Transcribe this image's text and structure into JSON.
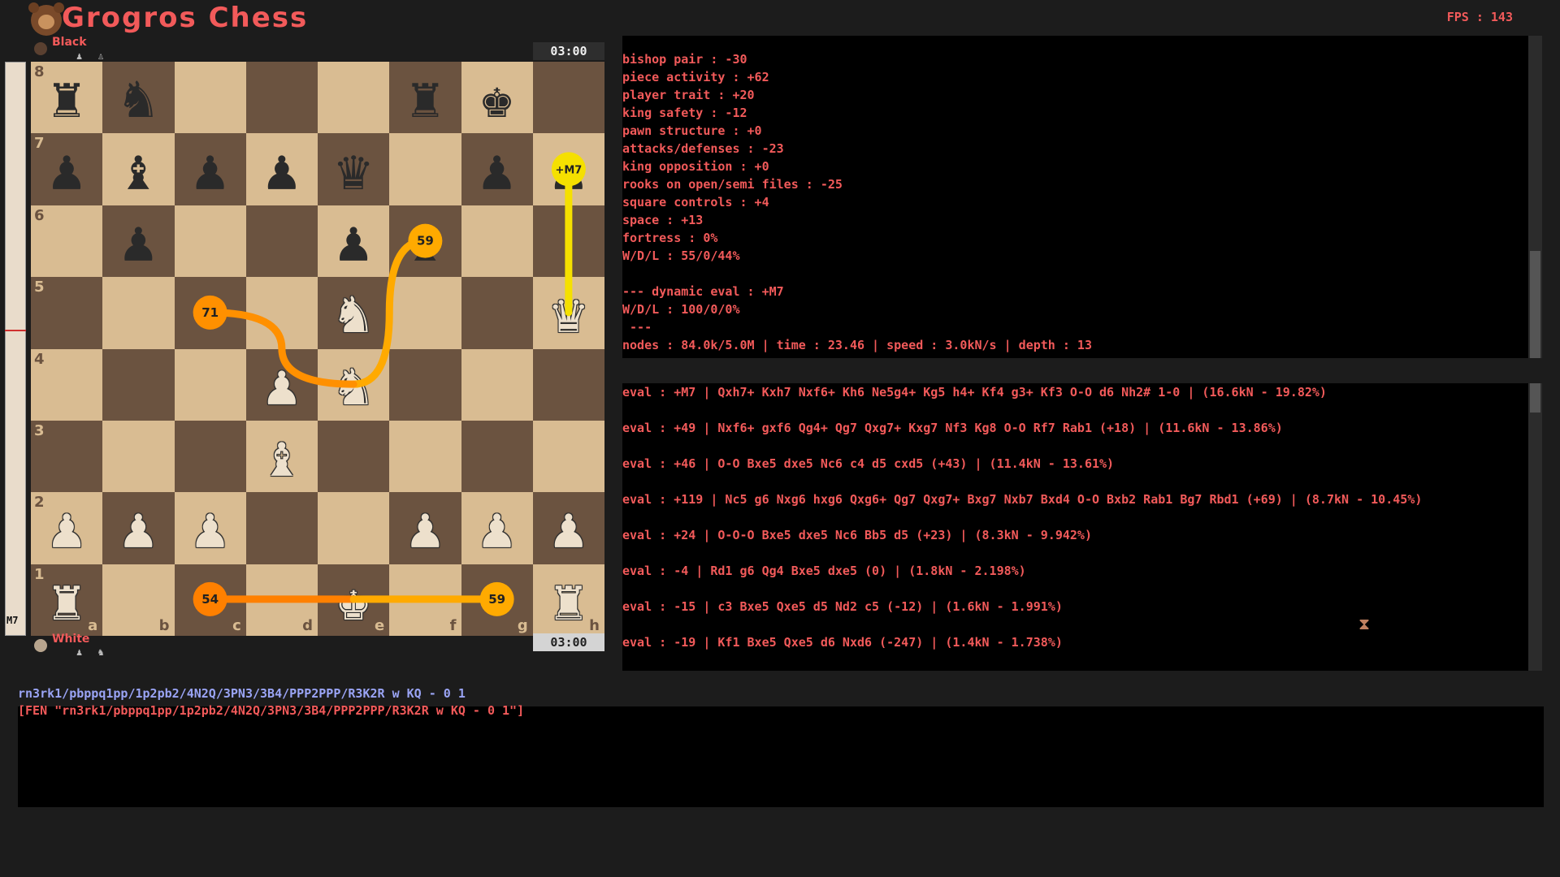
{
  "app": {
    "title": "Grogros Chess",
    "fps": "FPS : 143"
  },
  "players": {
    "black": {
      "name": "Black",
      "clock": "03:00",
      "captured": "♟ ♙"
    },
    "white": {
      "name": "White",
      "clock": "03:00",
      "captured": "♟ ♞"
    }
  },
  "eval_bar": {
    "text": "M7",
    "white_fraction": 0.47
  },
  "board": {
    "ranks": [
      "8",
      "7",
      "6",
      "5",
      "4",
      "3",
      "2",
      "1"
    ],
    "files": [
      "a",
      "b",
      "c",
      "d",
      "e",
      "f",
      "g",
      "h"
    ],
    "rows": [
      [
        "br",
        "bn",
        "",
        "",
        "",
        "br",
        "bk",
        ""
      ],
      [
        "bp",
        "bb",
        "bp",
        "bp",
        "bq",
        "",
        "bp",
        "bp"
      ],
      [
        "",
        "bp",
        "",
        "",
        "bp",
        "bb",
        "",
        ""
      ],
      [
        "",
        "",
        "",
        "",
        "wn",
        "",
        "",
        "wq"
      ],
      [
        "",
        "",
        "",
        "wp",
        "wn",
        "",
        "",
        ""
      ],
      [
        "",
        "",
        "",
        "wb",
        "",
        "",
        "",
        ""
      ],
      [
        "wp",
        "wp",
        "wp",
        "",
        "",
        "wp",
        "wp",
        "wp"
      ],
      [
        "wr",
        "",
        "",
        "",
        "wk",
        "",
        "",
        "wr"
      ]
    ]
  },
  "arrows": [
    {
      "label": "+M7",
      "from": "h5",
      "to": "h7",
      "color": "#f5e000"
    },
    {
      "label": "59",
      "from": "e4",
      "to": "f6",
      "color": "#ffaa00"
    },
    {
      "label": "71",
      "from": "e4",
      "to": "c5",
      "color": "#ff9000"
    },
    {
      "label": "54",
      "from": "e1",
      "to": "c1",
      "color": "#ff8000"
    },
    {
      "label": "59",
      "from": "e1",
      "to": "g1",
      "color": "#ffaa00"
    }
  ],
  "static_eval": [
    "bishop pair : -30",
    "piece activity : +62",
    "player trait : +20",
    "king safety : -12",
    "pawn structure : +0",
    "attacks/defenses : -23",
    "king opposition : +0",
    "rooks on open/semi files : -25",
    "square controls : +4",
    "space : +13",
    "fortress : 0%",
    "W/D/L : 55/0/44%",
    "",
    "--- dynamic eval : +M7",
    "W/D/L : 100/0/0%",
    " ---",
    "nodes : 84.0k/5.0M | time : 23.46 | speed : 3.0kN/s | depth : 13"
  ],
  "pv_lines": [
    "eval : +M7 | Qxh7+ Kxh7 Nxf6+ Kh6 Ne5g4+ Kg5 h4+ Kf4 g3+ Kf3 O-O d6 Nh2# 1-0 | (16.6kN - 19.82%)",
    "eval : +49 | Nxf6+ gxf6 Qg4+ Qg7 Qxg7+ Kxg7 Nf3 Kg8 O-O Rf7 Rab1 (+18) | (11.6kN - 13.86%)",
    "eval : +46 | O-O Bxe5 dxe5 Nc6 c4 d5 cxd5 (+43) | (11.4kN - 13.61%)",
    "eval : +119 | Nc5 g6 Nxg6 hxg6 Qxg6+ Qg7 Qxg7+ Bxg7 Nxb7 Bxd4 O-O Bxb2 Rab1 Bg7 Rbd1 (+69) | (8.7kN - 10.45%)",
    "eval : +24 | O-O-O Bxe5 dxe5 Nc6 Bb5 d5 (+23) | (8.3kN - 9.942%)",
    "eval : -4 | Rd1 g6 Qg4 Bxe5 dxe5 (0) | (1.8kN - 2.198%)",
    "eval : -15 | c3 Bxe5 Qxe5 d5 Nd2 c5 (-12) | (1.6kN - 1.991%)",
    "eval : -19 | Kf1 Bxe5 Qxe5 d6 Nxd6 (-247) | (1.4kN - 1.738%)"
  ],
  "fen": {
    "line": "rn3rk1/pbppq1pp/1p2pb2/4N2Q/3PN3/3B4/PPP2PPP/R3K2R w KQ - 0 1",
    "pgn_tag": "[FEN \"rn3rk1/pbppq1pp/1p2pb2/4N2Q/3PN3/3B4/PPP2PPP/R3K2R w KQ - 0 1\"]"
  },
  "colors": {
    "accent": "#f25a5a",
    "light_square": "#d9bc92",
    "dark_square": "#6b5340",
    "fen_blue": "#9aa4f5"
  }
}
